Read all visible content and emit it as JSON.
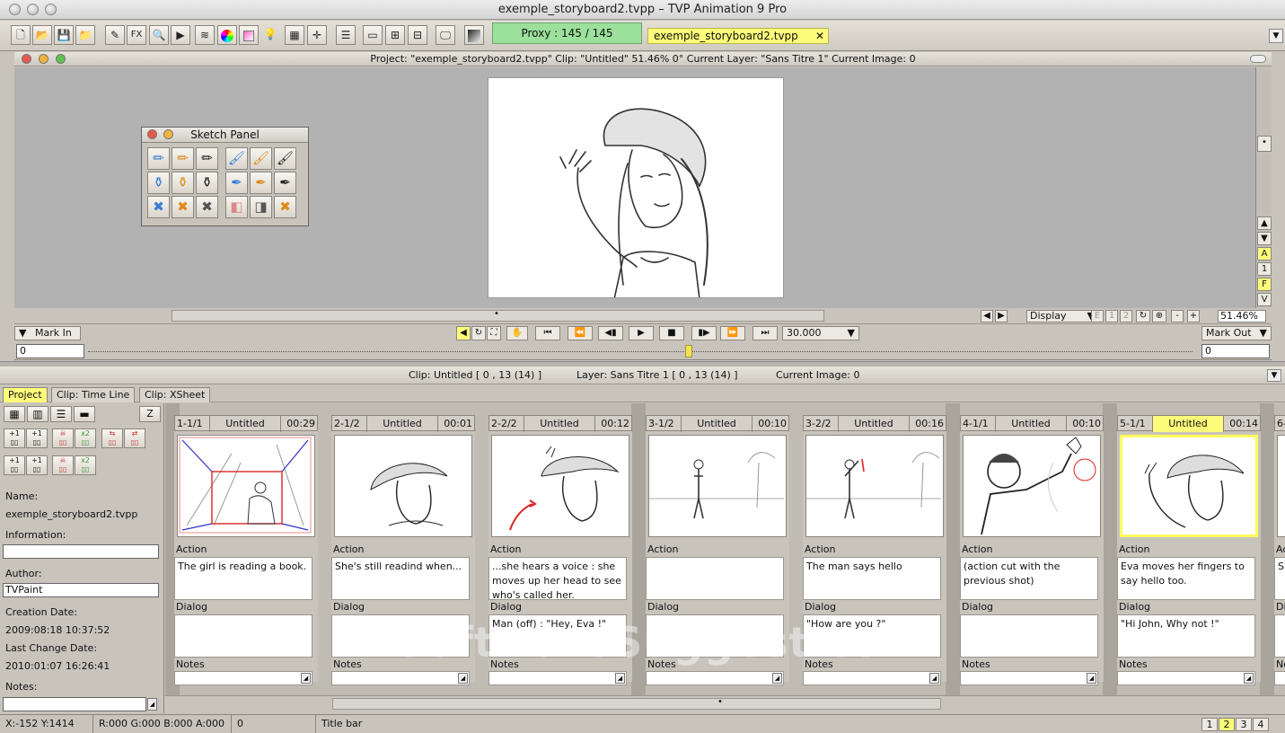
{
  "window": {
    "title": "exemple_storyboard2.tvpp – TVP Animation 9 Pro"
  },
  "toolbar": {
    "fx_label": "FX",
    "proxy_label": "Proxy : 145 / 145",
    "document_tab": "exemple_storyboard2.tvpp",
    "document_tab_close": "✕"
  },
  "project_window": {
    "info": "Project:  \"exemple_storyboard2.tvpp\"  Clip: \"Untitled\"   51.46%   0°   Current Layer: \"Sans Titre 1\"   Current Image: 0"
  },
  "sketch_panel": {
    "title": "Sketch Panel"
  },
  "right_strip": {
    "letters": [
      "A",
      "1",
      "F",
      "V"
    ]
  },
  "view_strip": {
    "display_label": "Display",
    "zoom_value": "51.46%",
    "page_buttons": [
      "1",
      "2"
    ]
  },
  "playback": {
    "mark_in": "Mark In",
    "mark_out": "Mark Out",
    "fps": "30.000",
    "in_frame": "0",
    "out_frame": "0"
  },
  "timeline": {
    "clip_info": "Clip: Untitled [ 0 , 13  (14) ]",
    "layer_info": "Layer: Sans Titre 1 [ 0 , 13  (14) ]",
    "current_image": "Current Image: 0"
  },
  "tabs": [
    {
      "label": "Project",
      "active": true
    },
    {
      "label": "Clip: Time Line",
      "active": false
    },
    {
      "label": "Clip: XSheet",
      "active": false
    }
  ],
  "left_panel": {
    "z_button": "Z",
    "labels": {
      "name": "Name:",
      "information": "Information:",
      "author": "Author:",
      "creation_date": "Creation Date:",
      "last_change_date": "Last Change Date:",
      "notes": "Notes:"
    },
    "values": {
      "name": "exemple_storyboard2.tvpp",
      "information": "",
      "author": "TVPaint",
      "creation_date": "2009:08:18 10:37:52",
      "last_change_date": "2010:01:07 16:26:41",
      "notes": ""
    }
  },
  "storyboard": {
    "section_labels": {
      "action": "Action",
      "dialog": "Dialog",
      "notes": "Notes"
    },
    "cards": [
      {
        "id": "1-1/1",
        "name": "Untitled",
        "time": "00:29",
        "action": "The girl is reading a book.",
        "dialog": "",
        "selected": false
      },
      {
        "id": "2-1/2",
        "name": "Untitled",
        "time": "00:01",
        "action": "She's still readind when...",
        "dialog": "",
        "selected": false
      },
      {
        "id": "2-2/2",
        "name": "Untitled",
        "time": "00:12",
        "action": "...she hears a voice : she moves up her head to see who's called her.",
        "dialog": "Man (off) : \"Hey, Eva !\"",
        "selected": false
      },
      {
        "id": "3-1/2",
        "name": "Untitled",
        "time": "00:10",
        "action": "",
        "dialog": "",
        "selected": false
      },
      {
        "id": "3-2/2",
        "name": "Untitled",
        "time": "00:16",
        "action": "The man says hello",
        "dialog": "\"How are you ?\"",
        "selected": false
      },
      {
        "id": "4-1/1",
        "name": "Untitled",
        "time": "00:10",
        "action": "(action cut with the previous shot)",
        "dialog": "",
        "selected": false
      },
      {
        "id": "5-1/1",
        "name": "Untitled",
        "time": "00:14",
        "action": "Eva moves her fingers to say hello too.",
        "dialog": "\"Hi John, Why not !\"",
        "selected": true
      },
      {
        "id": "6-",
        "name": "",
        "time": "",
        "action": "S",
        "dialog": "",
        "selected": false
      }
    ]
  },
  "status_bar": {
    "coords": "X:-152  Y:1414",
    "color": "R:000 G:000 B:000 A:000",
    "value": "0",
    "hint": "Title bar",
    "pages": [
      "1",
      "2",
      "3",
      "4"
    ]
  },
  "watermark": "SoftwareSuggest.com",
  "colors": {
    "accent_yellow": "#fcfc7a",
    "proxy_green": "#9be09b",
    "panel_gray": "#c8c4bc"
  }
}
